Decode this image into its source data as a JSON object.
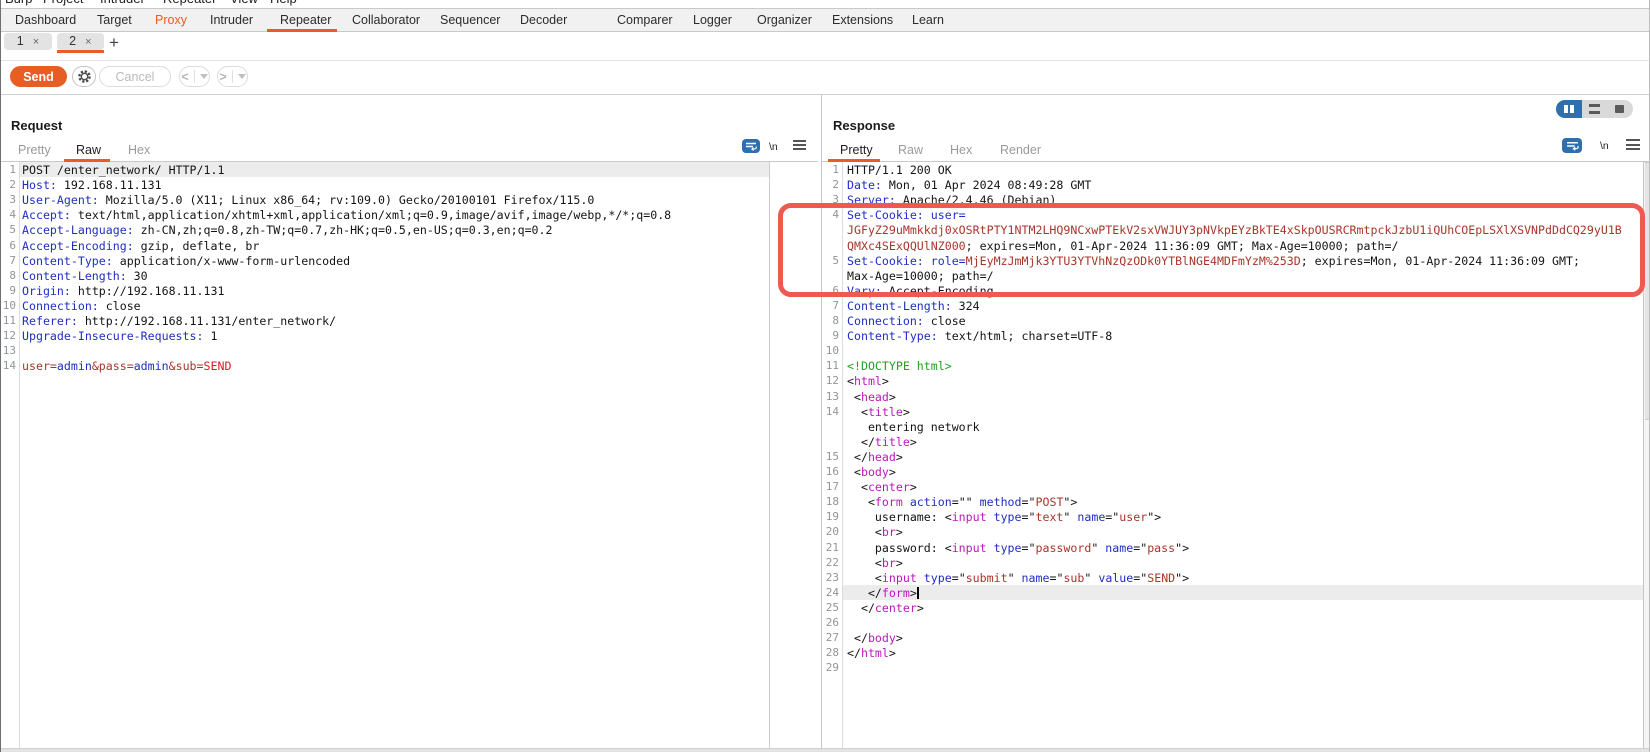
{
  "menu": {
    "items": [
      "Burp",
      "Project",
      "Intruder",
      "Repeater",
      "View",
      "Help"
    ]
  },
  "main_tabs": {
    "items": [
      "Dashboard",
      "Target",
      "Proxy",
      "Intruder",
      "Repeater",
      "Collaborator",
      "Sequencer",
      "Decoder",
      "Comparer",
      "Logger",
      "Organizer",
      "Extensions",
      "Learn"
    ],
    "selected": "Repeater",
    "accent": "Proxy",
    "accent_color": "#e75d24"
  },
  "repeater_tabs": {
    "items": [
      {
        "label": "1",
        "close": "×"
      },
      {
        "label": "2",
        "close": "×"
      }
    ],
    "selected": "2",
    "add_label": "+"
  },
  "toolbar": {
    "send_label": "Send",
    "cancel_label": "Cancel",
    "prev_label": "<",
    "next_label": ">"
  },
  "request": {
    "title": "Request",
    "tabs": [
      "Pretty",
      "Raw",
      "Hex"
    ],
    "selected_tab": "Raw",
    "newline_label": "\\n",
    "lines": [
      {
        "n": "1",
        "hl": true,
        "parts": [
          [
            "k",
            "POST /enter_network/ HTTP/1.1"
          ]
        ]
      },
      {
        "n": "2",
        "parts": [
          [
            "h",
            "Host:"
          ],
          [
            "k",
            " 192.168.11.131"
          ]
        ]
      },
      {
        "n": "3",
        "parts": [
          [
            "h",
            "User-Agent:"
          ],
          [
            "k",
            " Mozilla/5.0 (X11; Linux x86_64; rv:109.0) Gecko/20100101 Firefox/115.0"
          ]
        ]
      },
      {
        "n": "4",
        "parts": [
          [
            "h",
            "Accept:"
          ],
          [
            "k",
            " text/html,application/xhtml+xml,application/xml;q=0.9,image/avif,image/webp,*/*;q=0.8"
          ]
        ]
      },
      {
        "n": "5",
        "parts": [
          [
            "h",
            "Accept-Language:"
          ],
          [
            "k",
            " zh-CN,zh;q=0.8,zh-TW;q=0.7,zh-HK;q=0.5,en-US;q=0.3,en;q=0.2"
          ]
        ]
      },
      {
        "n": "6",
        "parts": [
          [
            "h",
            "Accept-Encoding:"
          ],
          [
            "k",
            " gzip, deflate, br"
          ]
        ]
      },
      {
        "n": "7",
        "parts": [
          [
            "h",
            "Content-Type:"
          ],
          [
            "k",
            " application/x-www-form-urlencoded"
          ]
        ]
      },
      {
        "n": "8",
        "parts": [
          [
            "h",
            "Content-Length:"
          ],
          [
            "k",
            " 30"
          ]
        ]
      },
      {
        "n": "9",
        "parts": [
          [
            "h",
            "Origin:"
          ],
          [
            "k",
            " http://192.168.11.131"
          ]
        ]
      },
      {
        "n": "10",
        "parts": [
          [
            "h",
            "Connection:"
          ],
          [
            "k",
            " close"
          ]
        ]
      },
      {
        "n": "11",
        "parts": [
          [
            "h",
            "Referer:"
          ],
          [
            "k",
            " http://192.168.11.131/enter_network/"
          ]
        ]
      },
      {
        "n": "12",
        "parts": [
          [
            "h",
            "Upgrade-Insecure-Requests:"
          ],
          [
            "k",
            " 1"
          ]
        ]
      },
      {
        "n": "13",
        "parts": []
      },
      {
        "n": "14",
        "parts": [
          [
            "m",
            "user="
          ],
          [
            "h",
            "admin"
          ],
          [
            "m",
            "&pass="
          ],
          [
            "h",
            "admin"
          ],
          [
            "m",
            "&sub="
          ],
          [
            "r",
            "SEND"
          ]
        ]
      }
    ]
  },
  "response": {
    "title": "Response",
    "tabs": [
      "Pretty",
      "Raw",
      "Hex",
      "Render"
    ],
    "selected_tab": "Pretty",
    "newline_label": "\\n",
    "lines": [
      {
        "n": "1",
        "parts": [
          [
            "k",
            "HTTP/1.1 200 OK"
          ]
        ]
      },
      {
        "n": "2",
        "parts": [
          [
            "h",
            "Date:"
          ],
          [
            "k",
            " Mon, 01 Apr 2024 08:49:28 GMT"
          ]
        ]
      },
      {
        "n": "3",
        "parts": [
          [
            "h",
            "Server:"
          ],
          [
            "k",
            " Apache/2.4.46 (Debian)"
          ]
        ]
      },
      {
        "n": "4",
        "parts": [
          [
            "h",
            "Set-Cookie:"
          ],
          [
            "k",
            " "
          ],
          [
            "h",
            "user="
          ]
        ]
      },
      {
        "n": "",
        "parts": [
          [
            "m",
            "JGFyZ29uMmkkdj0xOSRtPTY1NTM2LHQ9NCxwPTEkV2sxVWJUY3pNVkpEYzBkTE4xSkpOUSRCRmtpckJzbU1iQUhCOEpLSXlXSVNPdDdCQ29yU1B"
          ]
        ]
      },
      {
        "n": "",
        "parts": [
          [
            "m",
            "QMXc4SExQQUlNZ000"
          ],
          [
            "k",
            "; expires=Mon, 01-Apr-2024 11:36:09 GMT; Max-Age=10000; path=/"
          ]
        ]
      },
      {
        "n": "5",
        "parts": [
          [
            "h",
            "Set-Cookie:"
          ],
          [
            "k",
            " "
          ],
          [
            "h",
            "role="
          ],
          [
            "m",
            "MjEyMzJmMjk3YTU3YTVhNzQzODk0YTBlNGE4MDFmYzM%253D"
          ],
          [
            "k",
            "; expires=Mon, 01-Apr-2024 11:36:09 GMT;"
          ]
        ]
      },
      {
        "n": "",
        "parts": [
          [
            "k",
            "Max-Age=10000; path=/"
          ]
        ]
      },
      {
        "n": "6",
        "parts": [
          [
            "h",
            "Vary:"
          ],
          [
            "k",
            " Accept-Encoding"
          ]
        ]
      },
      {
        "n": "7",
        "parts": [
          [
            "h",
            "Content-Length:"
          ],
          [
            "k",
            " 324"
          ]
        ]
      },
      {
        "n": "8",
        "parts": [
          [
            "h",
            "Connection:"
          ],
          [
            "k",
            " close"
          ]
        ]
      },
      {
        "n": "9",
        "parts": [
          [
            "h",
            "Content-Type:"
          ],
          [
            "k",
            " text/html; charset=UTF-8"
          ]
        ]
      },
      {
        "n": "10",
        "parts": []
      },
      {
        "n": "11",
        "parts": [
          [
            "g",
            "<!DOCTYPE html>"
          ]
        ]
      },
      {
        "n": "12",
        "parts": [
          [
            "k",
            "<"
          ],
          [
            "t",
            "html"
          ],
          [
            "k",
            ">"
          ]
        ]
      },
      {
        "n": "13",
        "parts": [
          [
            "k",
            " <"
          ],
          [
            "t",
            "head"
          ],
          [
            "k",
            ">"
          ]
        ]
      },
      {
        "n": "14",
        "parts": [
          [
            "k",
            "  <"
          ],
          [
            "t",
            "title"
          ],
          [
            "k",
            ">"
          ]
        ]
      },
      {
        "n": "",
        "parts": [
          [
            "k",
            "   entering network"
          ]
        ]
      },
      {
        "n": "",
        "parts": [
          [
            "k",
            "  </"
          ],
          [
            "t",
            "title"
          ],
          [
            "k",
            ">"
          ]
        ]
      },
      {
        "n": "15",
        "parts": [
          [
            "k",
            " </"
          ],
          [
            "t",
            "head"
          ],
          [
            "k",
            ">"
          ]
        ]
      },
      {
        "n": "16",
        "parts": [
          [
            "k",
            " <"
          ],
          [
            "t",
            "body"
          ],
          [
            "k",
            ">"
          ]
        ]
      },
      {
        "n": "17",
        "parts": [
          [
            "k",
            "  <"
          ],
          [
            "t",
            "center"
          ],
          [
            "k",
            ">"
          ]
        ]
      },
      {
        "n": "18",
        "parts": [
          [
            "k",
            "   <"
          ],
          [
            "t",
            "form"
          ],
          [
            "k",
            " "
          ],
          [
            "h",
            "action"
          ],
          [
            "k",
            "=\"\" "
          ],
          [
            "h",
            "method"
          ],
          [
            "k",
            "=\""
          ],
          [
            "m",
            "POST"
          ],
          [
            "k",
            "\">"
          ]
        ]
      },
      {
        "n": "19",
        "parts": [
          [
            "k",
            "    username: <"
          ],
          [
            "t",
            "input"
          ],
          [
            "k",
            " "
          ],
          [
            "h",
            "type"
          ],
          [
            "k",
            "=\""
          ],
          [
            "m",
            "text"
          ],
          [
            "k",
            "\" "
          ],
          [
            "h",
            "name"
          ],
          [
            "k",
            "=\""
          ],
          [
            "m",
            "user"
          ],
          [
            "k",
            "\">"
          ]
        ]
      },
      {
        "n": "20",
        "parts": [
          [
            "k",
            "    <"
          ],
          [
            "t",
            "br"
          ],
          [
            "k",
            ">"
          ]
        ]
      },
      {
        "n": "21",
        "parts": [
          [
            "k",
            "    password: <"
          ],
          [
            "t",
            "input"
          ],
          [
            "k",
            " "
          ],
          [
            "h",
            "type"
          ],
          [
            "k",
            "=\""
          ],
          [
            "m",
            "password"
          ],
          [
            "k",
            "\" "
          ],
          [
            "h",
            "name"
          ],
          [
            "k",
            "=\""
          ],
          [
            "m",
            "pass"
          ],
          [
            "k",
            "\">"
          ]
        ]
      },
      {
        "n": "22",
        "parts": [
          [
            "k",
            "    <"
          ],
          [
            "t",
            "br"
          ],
          [
            "k",
            ">"
          ]
        ]
      },
      {
        "n": "23",
        "parts": [
          [
            "k",
            "    <"
          ],
          [
            "t",
            "input"
          ],
          [
            "k",
            " "
          ],
          [
            "h",
            "type"
          ],
          [
            "k",
            "=\""
          ],
          [
            "m",
            "submit"
          ],
          [
            "k",
            "\" "
          ],
          [
            "h",
            "name"
          ],
          [
            "k",
            "=\""
          ],
          [
            "m",
            "sub"
          ],
          [
            "k",
            "\" "
          ],
          [
            "h",
            "value"
          ],
          [
            "k",
            "=\""
          ],
          [
            "m",
            "SEND"
          ],
          [
            "k",
            "\">"
          ]
        ]
      },
      {
        "n": "24",
        "hl": true,
        "cursor": true,
        "parts": [
          [
            "k",
            "   </"
          ],
          [
            "t",
            "form"
          ],
          [
            "k",
            ">"
          ]
        ]
      },
      {
        "n": "25",
        "parts": [
          [
            "k",
            "  </"
          ],
          [
            "t",
            "center"
          ],
          [
            "k",
            ">"
          ]
        ]
      },
      {
        "n": "26",
        "parts": []
      },
      {
        "n": "27",
        "parts": [
          [
            "k",
            " </"
          ],
          [
            "t",
            "body"
          ],
          [
            "k",
            ">"
          ]
        ]
      },
      {
        "n": "28",
        "parts": [
          [
            "k",
            "</"
          ],
          [
            "t",
            "html"
          ],
          [
            "k",
            ">"
          ]
        ]
      },
      {
        "n": "29",
        "parts": []
      }
    ]
  },
  "colors": {
    "accent_orange": "#e75d24",
    "annotation_red": "#ee5a50",
    "icon_blue": "#2e6fac"
  }
}
